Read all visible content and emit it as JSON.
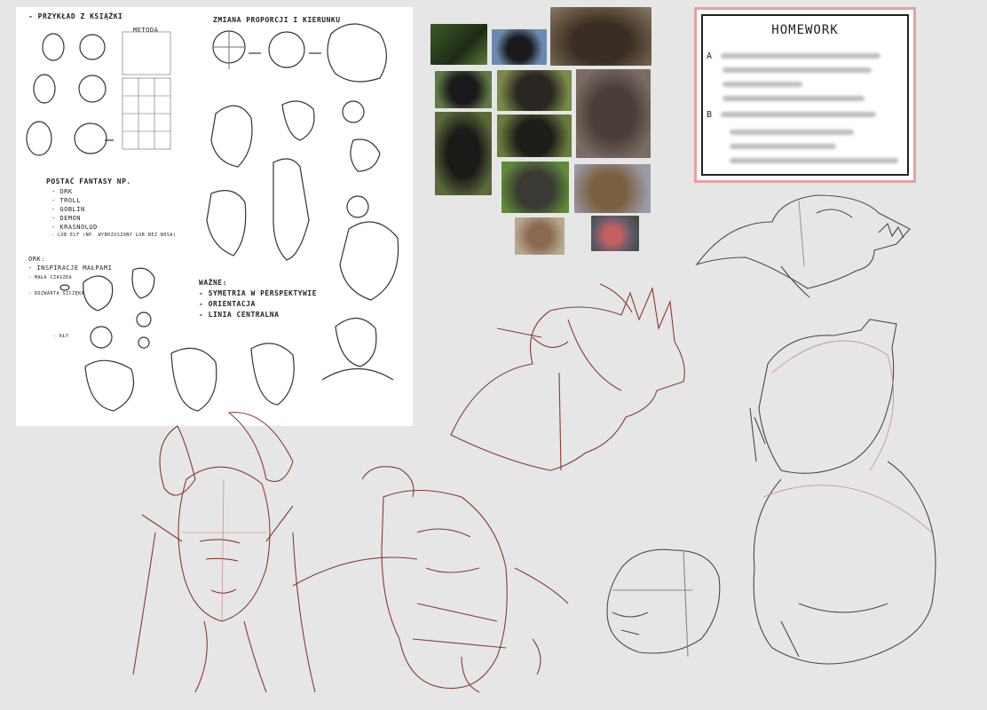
{
  "notes": {
    "heading_1": "- przykład z książki",
    "method_label": "metoda",
    "heading_2": "zmiana proporcji i kierunku",
    "fantasy_heading": "postać fantasy np.",
    "fantasy_list": [
      "- ork",
      "- troll",
      "- goblin",
      "- demon",
      "- krasnolud",
      "- lub elf (np. wybrzuszony lub bez nosa)"
    ],
    "orc_heading": "ork:",
    "orc_inspiration": "- inspiracje małpami",
    "orc_notes": [
      "- mała czaszka",
      "- rozwarta szczęka",
      "- kły"
    ],
    "important_heading": "ważne:",
    "important_list": [
      "- symetria w perspektywie",
      "- orientacja",
      "- linia centralna"
    ]
  },
  "homework": {
    "title": "HOMEWORK",
    "label_a": "A",
    "label_b": "B"
  },
  "colors": {
    "sketch_red": "#8a3a2e",
    "sketch_grey": "#4a4a4a",
    "homework_border": "#e7a0a0"
  }
}
